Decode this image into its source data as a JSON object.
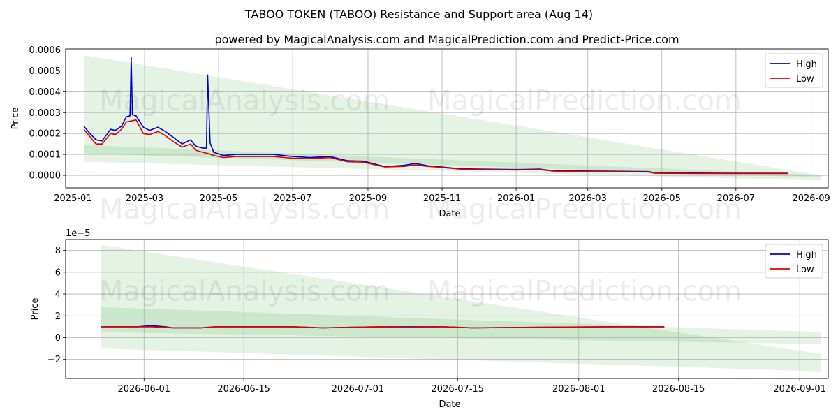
{
  "title": "TABOO TOKEN (TABOO) Resistance and Support area (Aug 14)",
  "subtitle": "powered by MagicalAnalysis.com and MagicalPrediction.com and Predict-Price.com",
  "watermarks": [
    "MagicalAnalysis.com",
    "MagicalPrediction.com"
  ],
  "colors": {
    "high": "#0000cc",
    "low": "#dd0000",
    "band": "#2ca02c",
    "grid": "#b0b0b0"
  },
  "chart_data": [
    {
      "type": "line",
      "xlabel": "Date",
      "ylabel": "Price",
      "grid": true,
      "legend": "top-right",
      "x_range": [
        "2024-12-26",
        "2026-09-15"
      ],
      "ylim": [
        -6e-05,
        0.000605
      ],
      "x_ticks": [
        "2025-01",
        "2025-03",
        "2025-05",
        "2025-07",
        "2025-09",
        "2025-11",
        "2026-01",
        "2026-03",
        "2026-05",
        "2026-07",
        "2026-09"
      ],
      "x_tick_dates": [
        "2025-01-01",
        "2025-03-01",
        "2025-05-01",
        "2025-07-01",
        "2025-09-01",
        "2025-11-01",
        "2026-01-01",
        "2026-03-01",
        "2026-05-01",
        "2026-07-01",
        "2026-09-01"
      ],
      "y_ticks": [
        "0.0000",
        "0.0001",
        "0.0002",
        "0.0003",
        "0.0004",
        "0.0005",
        "0.0006"
      ],
      "y_tick_values": [
        0,
        0.0001,
        0.0002,
        0.0003,
        0.0004,
        0.0005,
        0.0006
      ],
      "bands": [
        {
          "x": [
            "2025-01-10",
            "2026-09-09"
          ],
          "upper": [
            0.000575,
            0.0
          ],
          "lower": [
            6.5e-05,
            -2.5e-05
          ]
        },
        {
          "x": [
            "2025-01-10",
            "2026-09-09"
          ],
          "upper": [
            0.000145,
            2e-06
          ],
          "lower": [
            0.000105,
            -1e-05
          ]
        }
      ],
      "series": [
        {
          "name": "High",
          "x": [
            "2025-01-10",
            "2025-01-15",
            "2025-01-20",
            "2025-01-25",
            "2025-02-01",
            "2025-02-05",
            "2025-02-10",
            "2025-02-14",
            "2025-02-17",
            "2025-02-18",
            "2025-02-19",
            "2025-02-22",
            "2025-02-28",
            "2025-03-05",
            "2025-03-12",
            "2025-03-18",
            "2025-03-25",
            "2025-04-01",
            "2025-04-08",
            "2025-04-12",
            "2025-04-18",
            "2025-04-21",
            "2025-04-22",
            "2025-04-24",
            "2025-04-27",
            "2025-05-05",
            "2025-05-15",
            "2025-06-01",
            "2025-06-15",
            "2025-07-01",
            "2025-07-15",
            "2025-08-01",
            "2025-08-15",
            "2025-08-28",
            "2025-09-15",
            "2025-10-01",
            "2025-10-10",
            "2025-10-20",
            "2025-11-01",
            "2025-11-15",
            "2025-12-01",
            "2026-01-01",
            "2026-01-20",
            "2026-02-01",
            "2026-03-15",
            "2026-04-20",
            "2026-04-25",
            "2026-06-01",
            "2026-07-01",
            "2026-08-13"
          ],
          "values": [
            0.000235,
            0.0002,
            0.00017,
            0.000165,
            0.00022,
            0.000215,
            0.000235,
            0.00028,
            0.000285,
            0.000565,
            0.00029,
            0.000285,
            0.00023,
            0.000215,
            0.00023,
            0.00021,
            0.00018,
            0.00015,
            0.00017,
            0.00014,
            0.00013,
            0.00013,
            0.00048,
            0.000155,
            0.00011,
            9.5e-05,
            0.0001,
            0.0001,
            0.0001,
            9e-05,
            8.5e-05,
            9e-05,
            7e-05,
            6.8e-05,
            4.2e-05,
            4.8e-05,
            5.7e-05,
            4.6e-05,
            4e-05,
            3.2e-05,
            3e-05,
            2.8e-05,
            3e-05,
            2.2e-05,
            2e-05,
            1.8e-05,
            1.2e-05,
            1.1e-05,
            1e-05,
            1e-05
          ]
        },
        {
          "name": "Low",
          "x": [
            "2025-01-10",
            "2025-01-15",
            "2025-01-20",
            "2025-01-25",
            "2025-02-01",
            "2025-02-05",
            "2025-02-10",
            "2025-02-14",
            "2025-02-18",
            "2025-02-22",
            "2025-02-28",
            "2025-03-05",
            "2025-03-12",
            "2025-03-18",
            "2025-03-25",
            "2025-04-01",
            "2025-04-08",
            "2025-04-12",
            "2025-04-18",
            "2025-04-22",
            "2025-04-27",
            "2025-05-05",
            "2025-05-15",
            "2025-06-01",
            "2025-06-15",
            "2025-07-01",
            "2025-07-15",
            "2025-08-01",
            "2025-08-15",
            "2025-08-28",
            "2025-09-15",
            "2025-10-01",
            "2025-10-10",
            "2025-10-20",
            "2025-11-01",
            "2025-11-15",
            "2025-12-01",
            "2026-01-01",
            "2026-01-20",
            "2026-02-01",
            "2026-03-15",
            "2026-04-20",
            "2026-04-25",
            "2026-06-01",
            "2026-07-01",
            "2026-08-13"
          ],
          "values": [
            0.00022,
            0.000185,
            0.00015,
            0.00015,
            0.0002,
            0.000195,
            0.00022,
            0.000255,
            0.00026,
            0.000265,
            0.0002,
            0.000195,
            0.00021,
            0.00019,
            0.00016,
            0.000135,
            0.00015,
            0.00012,
            0.00011,
            0.000105,
            9.5e-05,
            8.5e-05,
            9e-05,
            9e-05,
            9e-05,
            8.2e-05,
            8e-05,
            8.5e-05,
            6.5e-05,
            6.3e-05,
            4e-05,
            4.3e-05,
            5e-05,
            4.3e-05,
            3.8e-05,
            3e-05,
            2.8e-05,
            2.6e-05,
            2.8e-05,
            2e-05,
            1.8e-05,
            1.6e-05,
            1e-05,
            9e-06,
            9e-06,
            9e-06
          ]
        }
      ]
    },
    {
      "type": "line",
      "xlabel": "Date",
      "ylabel": "Price",
      "grid": true,
      "legend": "top-right",
      "scale_label": "1e−5",
      "x_range": [
        "2026-05-21",
        "2026-09-05"
      ],
      "ylim": [
        -3.75,
        9.0
      ],
      "x_ticks": [
        "2026-06-01",
        "2026-06-15",
        "2026-07-01",
        "2026-07-15",
        "2026-08-01",
        "2026-08-15",
        "2026-09-01"
      ],
      "x_tick_dates": [
        "2026-06-01",
        "2026-06-15",
        "2026-07-01",
        "2026-07-15",
        "2026-08-01",
        "2026-08-15",
        "2026-09-01"
      ],
      "y_ticks": [
        "−2",
        "0",
        "2",
        "4",
        "6",
        "8"
      ],
      "y_tick_values": [
        -2,
        0,
        2,
        4,
        6,
        8
      ],
      "bands": [
        {
          "x": [
            "2026-05-26",
            "2026-09-04"
          ],
          "upper": [
            8.5,
            -1.5
          ],
          "lower": [
            -1.0,
            -3.1
          ]
        },
        {
          "x": [
            "2026-05-26",
            "2026-09-04"
          ],
          "upper": [
            2.8,
            0.5
          ],
          "lower": [
            0.5,
            -0.6
          ]
        }
      ],
      "series": [
        {
          "name": "High",
          "x": [
            "2026-05-26",
            "2026-05-31",
            "2026-06-02",
            "2026-06-04",
            "2026-06-05",
            "2026-06-09",
            "2026-06-11",
            "2026-06-20",
            "2026-06-22",
            "2026-06-26",
            "2026-07-04",
            "2026-07-08",
            "2026-07-13",
            "2026-07-17",
            "2026-08-05",
            "2026-08-13"
          ],
          "values": [
            1.0,
            1.0,
            1.1,
            1.0,
            0.9,
            0.9,
            1.0,
            1.0,
            1.0,
            0.9,
            1.0,
            1.0,
            1.0,
            0.9,
            1.0,
            1.0
          ]
        },
        {
          "name": "Low",
          "x": [
            "2026-05-26",
            "2026-05-31",
            "2026-06-02",
            "2026-06-04",
            "2026-06-05",
            "2026-06-09",
            "2026-06-11",
            "2026-06-20",
            "2026-06-22",
            "2026-06-26",
            "2026-07-04",
            "2026-07-08",
            "2026-07-13",
            "2026-07-17",
            "2026-08-05",
            "2026-08-13"
          ],
          "values": [
            1.0,
            1.0,
            1.0,
            0.95,
            0.9,
            0.9,
            1.0,
            1.0,
            1.0,
            0.9,
            1.0,
            0.95,
            1.0,
            0.9,
            1.0,
            1.0
          ]
        }
      ]
    }
  ]
}
